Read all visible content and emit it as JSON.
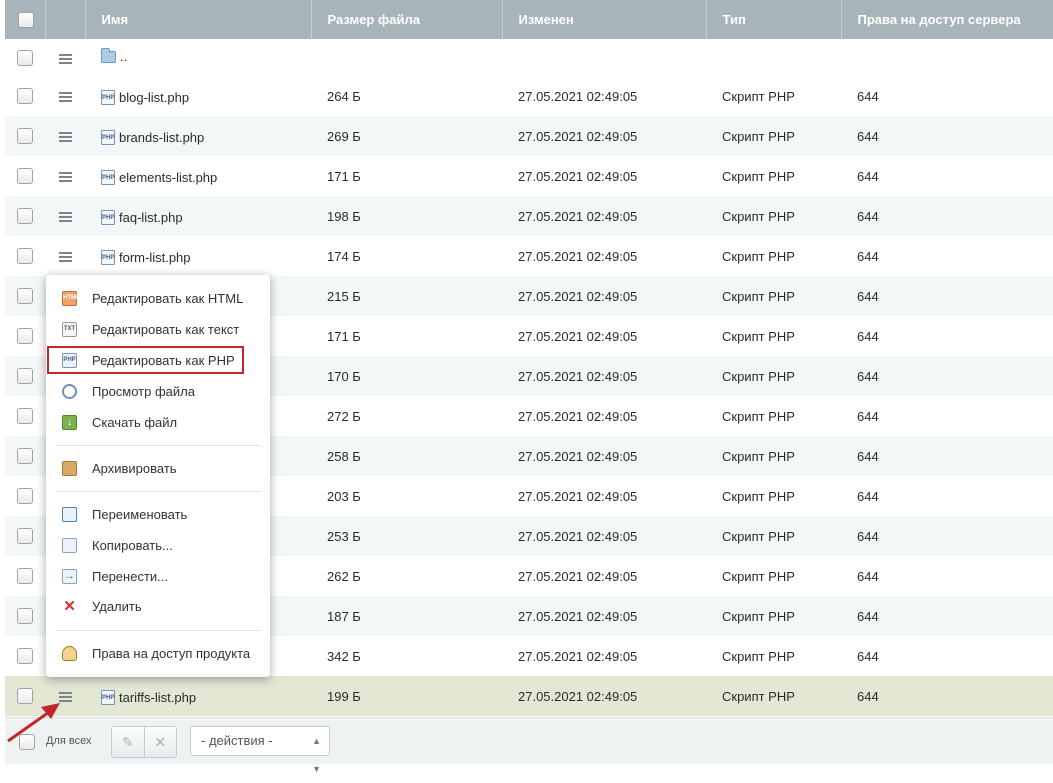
{
  "columns": [
    "Имя",
    "Размер файла",
    "Изменен",
    "Тип",
    "Права на доступ сервера"
  ],
  "up_label": "..",
  "rows": [
    {
      "name": "blog-list.php",
      "size": "264 Б",
      "date": "27.05.2021 02:49:05",
      "type": "Скрипт PHP",
      "perm": "644"
    },
    {
      "name": "brands-list.php",
      "size": "269 Б",
      "date": "27.05.2021 02:49:05",
      "type": "Скрипт PHP",
      "perm": "644"
    },
    {
      "name": "elements-list.php",
      "size": "171 Б",
      "date": "27.05.2021 02:49:05",
      "type": "Скрипт PHP",
      "perm": "644"
    },
    {
      "name": "faq-list.php",
      "size": "198 Б",
      "date": "27.05.2021 02:49:05",
      "type": "Скрипт PHP",
      "perm": "644"
    },
    {
      "name": "form-list.php",
      "size": "174 Б",
      "date": "27.05.2021 02:49:05",
      "type": "Скрипт PHP",
      "perm": "644"
    },
    {
      "name": "",
      "size": "215 Б",
      "date": "27.05.2021 02:49:05",
      "type": "Скрипт PHP",
      "perm": "644"
    },
    {
      "name": "",
      "size": "171 Б",
      "date": "27.05.2021 02:49:05",
      "type": "Скрипт PHP",
      "perm": "644"
    },
    {
      "name": "",
      "size": "170 Б",
      "date": "27.05.2021 02:49:05",
      "type": "Скрипт PHP",
      "perm": "644"
    },
    {
      "name": "",
      "size": "272 Б",
      "date": "27.05.2021 02:49:05",
      "type": "Скрипт PHP",
      "perm": "644"
    },
    {
      "name": "",
      "size": "258 Б",
      "date": "27.05.2021 02:49:05",
      "type": "Скрипт PHP",
      "perm": "644"
    },
    {
      "name": "",
      "size": "203 Б",
      "date": "27.05.2021 02:49:05",
      "type": "Скрипт PHP",
      "perm": "644"
    },
    {
      "name": "",
      "size": "253 Б",
      "date": "27.05.2021 02:49:05",
      "type": "Скрипт PHP",
      "perm": "644"
    },
    {
      "name": "",
      "size": "262 Б",
      "date": "27.05.2021 02:49:05",
      "type": "Скрипт PHP",
      "perm": "644"
    },
    {
      "name": "",
      "size": "187 Б",
      "date": "27.05.2021 02:49:05",
      "type": "Скрипт PHP",
      "perm": "644"
    },
    {
      "name": "",
      "size": "342 Б",
      "date": "27.05.2021 02:49:05",
      "type": "Скрипт PHP",
      "perm": "644"
    },
    {
      "name": "tariffs-list.php",
      "size": "199 Б",
      "date": "27.05.2021 02:49:05",
      "type": "Скрипт PHP",
      "perm": "644"
    }
  ],
  "menu": {
    "edit_html": "Редактировать как HTML",
    "edit_text": "Редактировать как текст",
    "edit_php": "Редактировать как PHP",
    "view": "Просмотр файла",
    "download": "Скачать файл",
    "archive": "Архивировать",
    "rename": "Переименовать",
    "copy": "Копировать...",
    "move": "Перенести...",
    "delete": "Удалить",
    "rights": "Права на доступ продукта"
  },
  "footer": {
    "for_all": "Для всех",
    "actions": "- действия -"
  },
  "colors": {
    "header_bg": "#a7b5ba",
    "selected_row": "#e2e8d4",
    "highlight": "#c1272d"
  }
}
